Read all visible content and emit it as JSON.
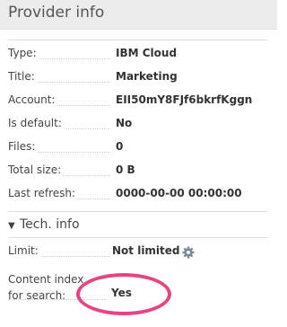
{
  "header": {
    "title": "Provider info"
  },
  "info_rows": [
    {
      "label": "Type:",
      "value": "IBM Cloud"
    },
    {
      "label": "Title:",
      "value": "Marketing"
    },
    {
      "label": "Account:",
      "value": "EII50mY8FJf6bkrfKggn"
    },
    {
      "label": "Is default:",
      "value": "No"
    },
    {
      "label": "Files:",
      "value": "0"
    },
    {
      "label": "Total size:",
      "value": "0 B"
    },
    {
      "label": "Last refresh:",
      "value": "0000-00-00 00:00:00"
    }
  ],
  "tech_info": {
    "title": "Tech. info",
    "limit": {
      "label": "Limit:",
      "value": "Not limited",
      "icon": "gear-icon"
    },
    "content_index": {
      "label_line1": "Content index",
      "label_line2": "for search:",
      "value": "Yes"
    }
  },
  "colors": {
    "header_bg": "#ececec",
    "highlight": "#e84482",
    "gear": "#7a8a99"
  }
}
